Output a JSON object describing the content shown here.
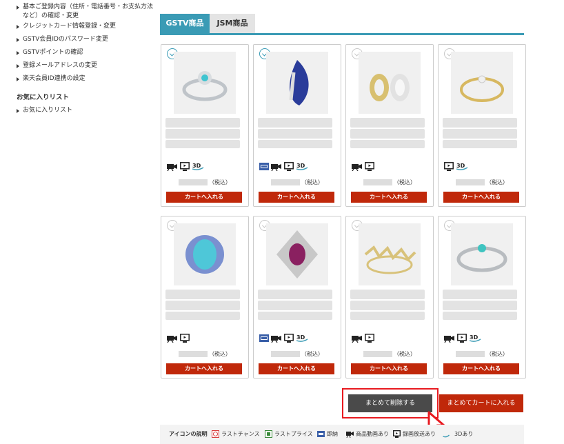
{
  "sidebar": {
    "items": [
      {
        "label": "基本ご登録内容（住所・電話番号・お支払方法など）の確認・変更"
      },
      {
        "label": "クレジットカード情報登録・変更"
      },
      {
        "label": "GSTV会員IDのパスワード変更"
      },
      {
        "label": "GSTVポイントの確認"
      },
      {
        "label": "登録メールアドレスの変更"
      },
      {
        "label": "楽天会員ID連携の設定"
      }
    ],
    "favorites_heading": "お気に入りリスト",
    "favorites_items": [
      {
        "label": "お気に入りリスト"
      }
    ]
  },
  "tabs": [
    {
      "label": "GSTV商品",
      "active": true
    },
    {
      "label": "JSM商品",
      "active": false
    }
  ],
  "products": [
    {
      "checked": true,
      "image": "ring-paraiba-halo",
      "icons": [
        "video-icon",
        "tv-icon",
        "3d-icon"
      ],
      "price_suffix": "（税込）",
      "cart_label": "カートへ入れる"
    },
    {
      "checked": true,
      "image": "sapphire-pendant",
      "icons": [
        "limited-icon",
        "video-icon",
        "tv-icon",
        "3d-icon"
      ],
      "price_suffix": "（税込）",
      "cart_label": "カートへ入れる"
    },
    {
      "checked": false,
      "image": "gold-earrings",
      "icons": [
        "video-icon",
        "tv-icon"
      ],
      "price_suffix": "（税込）",
      "cart_label": "カートへ入れる"
    },
    {
      "checked": false,
      "image": "yellow-gold-ring",
      "icons": [
        "tv-icon",
        "3d-icon"
      ],
      "price_suffix": "（税込）",
      "cart_label": "カートへ入れる"
    },
    {
      "checked": false,
      "image": "turquoise-ring",
      "icons": [
        "video-icon",
        "tv-icon"
      ],
      "price_suffix": "（税込）",
      "cart_label": "カートへ入れる"
    },
    {
      "checked": false,
      "image": "ruby-ring",
      "icons": [
        "limited-icon",
        "video-icon",
        "tv-icon",
        "3d-icon"
      ],
      "price_suffix": "（税込）",
      "cart_label": "カートへ入れる"
    },
    {
      "checked": false,
      "image": "zigzag-ring",
      "icons": [
        "video-icon",
        "tv-icon"
      ],
      "price_suffix": "（税込）",
      "cart_label": "カートへ入れる"
    },
    {
      "checked": false,
      "image": "eternity-ring",
      "icons": [
        "video-icon",
        "tv-icon",
        "3d-icon"
      ],
      "price_suffix": "（税込）",
      "cart_label": "カートへ入れる"
    }
  ],
  "actions": {
    "delete_label": "まとめて削除する",
    "cart_all_label": "まとめてカートに入れる"
  },
  "legend": {
    "title": "アイコンの説明",
    "items": [
      {
        "label": "ラストチャンス",
        "icon": "last-chance-icon"
      },
      {
        "label": "ラストプライス",
        "icon": "last-price-icon"
      },
      {
        "label": "即納",
        "icon": "immediate-delivery-icon"
      },
      {
        "label": "商品動画あり",
        "icon": "video-icon"
      },
      {
        "label": "録画放送あり",
        "icon": "tv-icon"
      },
      {
        "label": "3Dあり",
        "icon": "3d-icon"
      }
    ]
  },
  "colors": {
    "accent": "#3a9bb5",
    "cart_red": "#c0280a",
    "delete_dark": "#4a4a4a",
    "highlight_red": "#e8191f"
  }
}
